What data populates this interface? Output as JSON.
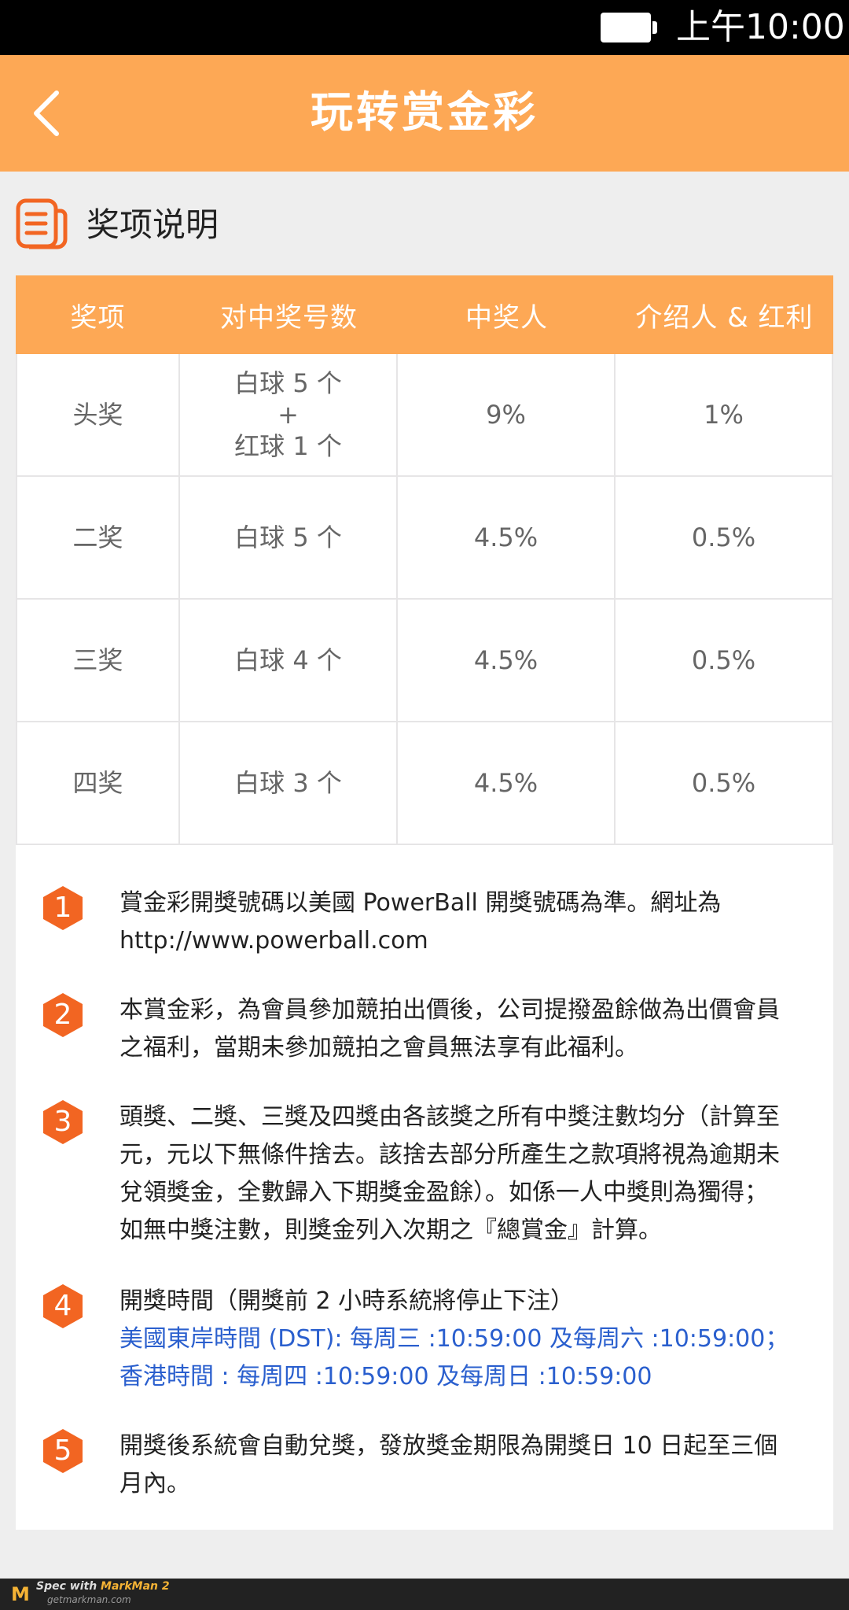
{
  "status_bar": {
    "time": "上午10:00"
  },
  "header": {
    "title": "玩转赏金彩"
  },
  "section": {
    "title": "奖项说明"
  },
  "table": {
    "headers": [
      "奖项",
      "对中奖号数",
      "中奖人",
      "介绍人 & 红利"
    ],
    "rows": [
      {
        "prize": "头奖",
        "match_line1": "白球 5 个",
        "match_line2": "+",
        "match_line3": "红球 1 个",
        "winner": "9%",
        "referrer": "1%"
      },
      {
        "prize": "二奖",
        "match": "白球 5 个",
        "winner": "4.5%",
        "referrer": "0.5%"
      },
      {
        "prize": "三奖",
        "match": "白球 4 个",
        "winner": "4.5%",
        "referrer": "0.5%"
      },
      {
        "prize": "四奖",
        "match": "白球 3 个",
        "winner": "4.5%",
        "referrer": "0.5%"
      }
    ]
  },
  "rules": [
    {
      "num": "1",
      "line1": "賞金彩開獎號碼以美國 PowerBall 開獎號碼為準。網址為",
      "line2": "http://www.powerball.com"
    },
    {
      "num": "2",
      "line1": "本賞金彩，為會員參加競拍出價後，公司提撥盈餘做為出價會員",
      "line2": "之福利，當期未參加競拍之會員無法享有此福利。"
    },
    {
      "num": "3",
      "line1": "頭獎、二獎、三獎及四獎由各該獎之所有中獎注數均分（計算至",
      "line2": "元，元以下無條件捨去。該捨去部分所產生之款項將視為逾期未",
      "line3": "兌領獎金，全數歸入下期獎金盈餘）。如係一人中獎則為獨得；",
      "line4": "如無中獎注數，則獎金列入次期之『總賞金』計算。"
    },
    {
      "num": "4",
      "line1": "開獎時間（開獎前 2 小時系統將停止下注）",
      "line2": "美國東岸時間 (DST): 每周三 :10:59:00 及每周六 :10:59:00；",
      "line3": "香港時間 : 每周四 :10:59:00 及每周日 :10:59:00"
    },
    {
      "num": "5",
      "line1": "開獎後系統會自動兌獎，發放獎金期限為開獎日 10 日起至三個",
      "line2": "月內。"
    }
  ],
  "footer": {
    "line1_prefix": "Spec with ",
    "brand": "MarkMan 2",
    "line2": "getmarkman.com"
  },
  "colors": {
    "accent": "#fda855",
    "text_gray": "#666666",
    "divider": "#e6e5e6",
    "link_blue": "#2a5fce",
    "background": "#eeeeee",
    "badge": "#f26522"
  }
}
